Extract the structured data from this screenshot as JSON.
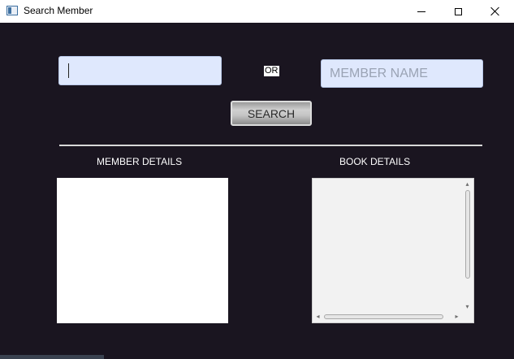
{
  "window": {
    "title": "Search Member",
    "controls": {
      "minimize": "minimize-icon",
      "maximize": "maximize-icon",
      "close": "close-icon"
    }
  },
  "form": {
    "member_id": {
      "value": "",
      "placeholder": ""
    },
    "or_label": "OR",
    "member_name": {
      "value": "",
      "placeholder": "MEMBER NAME"
    },
    "search_label": "SEARCH"
  },
  "results": {
    "member_details": {
      "heading": "MEMBER DETAILS",
      "content": ""
    },
    "book_details": {
      "heading": "BOOK DETAILS",
      "content": ""
    }
  },
  "colors": {
    "background": "#1a1520",
    "input_background": "#dfe8fd",
    "button_gray": "#c4c4c4",
    "heading_text": "#ffffff"
  }
}
